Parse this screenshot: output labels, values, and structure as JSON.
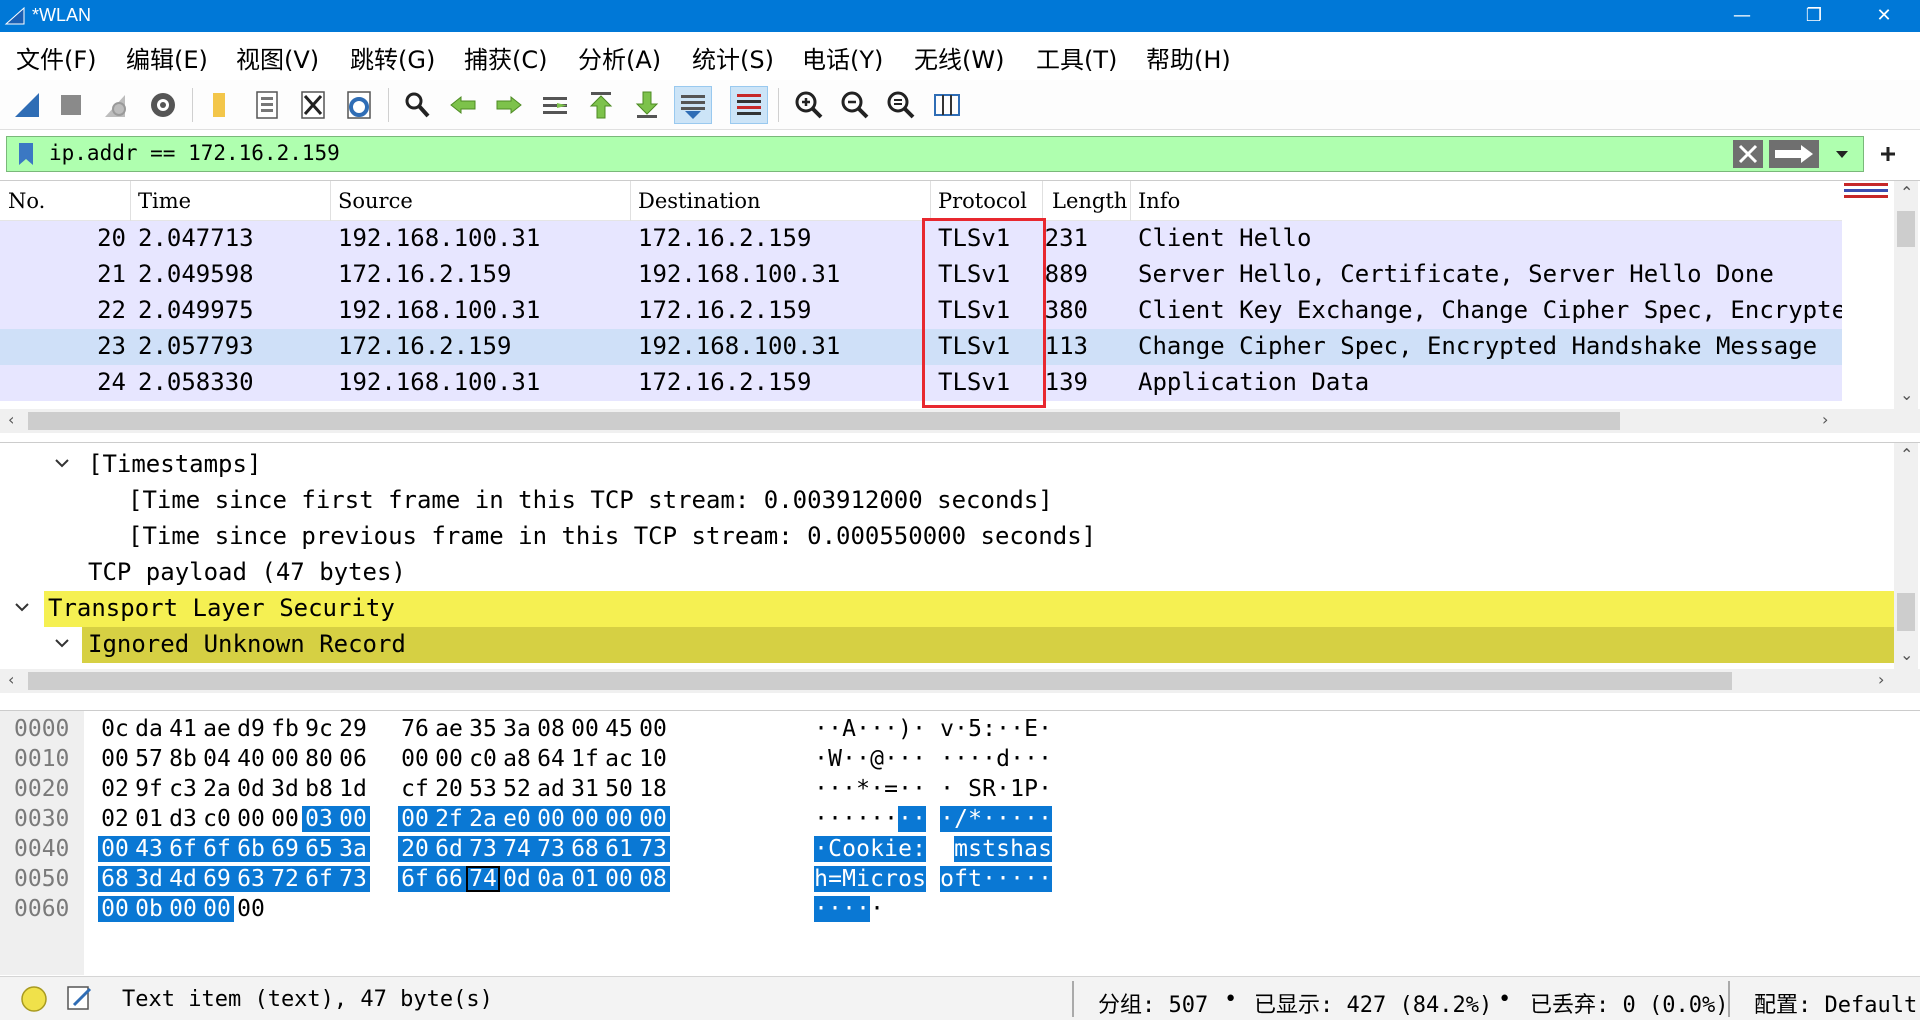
{
  "window": {
    "title": "*WLAN",
    "controls": {
      "minimize": "—",
      "restore": "❐",
      "close": "✕"
    }
  },
  "menu": [
    "文件(F)",
    "编辑(E)",
    "视图(V)",
    "跳转(G)",
    "捕获(C)",
    "分析(A)",
    "统计(S)",
    "电话(Y)",
    "无线(W)",
    "工具(T)",
    "帮助(H)"
  ],
  "toolbar": {
    "icons": [
      "shark-fin-start-icon",
      "stop-capture-icon",
      "restart-capture-icon",
      "capture-options-icon",
      "open-file-icon",
      "save-file-icon",
      "close-file-icon",
      "reload-file-icon",
      "find-packet-icon",
      "go-back-icon",
      "go-forward-icon",
      "go-to-packet-icon",
      "go-first-icon",
      "go-last-icon",
      "autoscroll-icon",
      "colorize-icon",
      "zoom-in-icon",
      "zoom-out-icon",
      "normal-size-icon",
      "resize-columns-icon"
    ]
  },
  "filter": {
    "value": "ip.addr == 172.16.2.159",
    "bg_color": "#afffaf"
  },
  "packet_list": {
    "columns": [
      "No.",
      "Time",
      "Source",
      "Destination",
      "Protocol",
      "Length",
      "Info"
    ],
    "rows": [
      {
        "no": "20",
        "time": "2.047713",
        "src": "192.168.100.31",
        "dst": "172.16.2.159",
        "proto": "TLSv1",
        "len": "231",
        "info": "Client Hello"
      },
      {
        "no": "21",
        "time": "2.049598",
        "src": "172.16.2.159",
        "dst": "192.168.100.31",
        "proto": "TLSv1",
        "len": "889",
        "info": "Server Hello, Certificate, Server Hello Done"
      },
      {
        "no": "22",
        "time": "2.049975",
        "src": "192.168.100.31",
        "dst": "172.16.2.159",
        "proto": "TLSv1",
        "len": "380",
        "info": "Client Key Exchange, Change Cipher Spec, Encrypted"
      },
      {
        "no": "23",
        "time": "2.057793",
        "src": "172.16.2.159",
        "dst": "192.168.100.31",
        "proto": "TLSv1",
        "len": "113",
        "info": "Change Cipher Spec, Encrypted Handshake Message",
        "selected": true
      },
      {
        "no": "24",
        "time": "2.058330",
        "src": "192.168.100.31",
        "dst": "172.16.2.159",
        "proto": "TLSv1",
        "len": "139",
        "info": "Application Data"
      }
    ],
    "row_color": "#e7e6ff",
    "highlight_color": "#e8282f"
  },
  "details": [
    {
      "text": "[Timestamps]",
      "expanded": true,
      "indent": 1
    },
    {
      "text": "[Time since first frame in this TCP stream: 0.003912000 seconds]",
      "indent": 2
    },
    {
      "text": "[Time since previous frame in this TCP stream: 0.000550000 seconds]",
      "indent": 2
    },
    {
      "text": "TCP payload (47 bytes)",
      "indent": 1
    },
    {
      "text": "Transport Layer Security",
      "expanded": true,
      "indent": 0,
      "color": "#f5f052"
    },
    {
      "text": "Ignored Unknown Record",
      "expanded": true,
      "indent": 1,
      "color": "#d6d043"
    }
  ],
  "bytes": {
    "rows": [
      {
        "offset": "0000",
        "hex": [
          "0c",
          "da",
          "41",
          "ae",
          "d9",
          "fb",
          "9c",
          "29",
          "76",
          "ae",
          "35",
          "3a",
          "08",
          "00",
          "45",
          "00"
        ],
        "ascii": [
          "·",
          "·",
          "A",
          "·",
          "·",
          "·",
          ")",
          "·",
          "v",
          "·",
          "5",
          ":",
          "·",
          "·",
          "E",
          "·"
        ]
      },
      {
        "offset": "0010",
        "hex": [
          "00",
          "57",
          "8b",
          "04",
          "40",
          "00",
          "80",
          "06",
          "00",
          "00",
          "c0",
          "a8",
          "64",
          "1f",
          "ac",
          "10"
        ],
        "ascii": [
          "·",
          "W",
          "·",
          "·",
          "@",
          "·",
          "·",
          "·",
          "·",
          "·",
          "·",
          "·",
          "d",
          "·",
          "·",
          "·"
        ]
      },
      {
        "offset": "0020",
        "hex": [
          "02",
          "9f",
          "c3",
          "2a",
          "0d",
          "3d",
          "b8",
          "1d",
          "cf",
          "20",
          "53",
          "52",
          "ad",
          "31",
          "50",
          "18"
        ],
        "ascii": [
          "·",
          "·",
          "·",
          "*",
          "·",
          "=",
          "·",
          "·",
          "·",
          " ",
          "S",
          "R",
          "·",
          "1",
          "P",
          "·"
        ]
      },
      {
        "offset": "0030",
        "hex": [
          "02",
          "01",
          "d3",
          "c0",
          "00",
          "00",
          "03",
          "00",
          "00",
          "2f",
          "2a",
          "e0",
          "00",
          "00",
          "00",
          "00"
        ],
        "ascii": [
          "·",
          "·",
          "·",
          "·",
          "·",
          "·",
          "·",
          "·",
          "·",
          "/",
          "*",
          "·",
          "·",
          "·",
          "·",
          "·"
        ]
      },
      {
        "offset": "0040",
        "hex": [
          "00",
          "43",
          "6f",
          "6f",
          "6b",
          "69",
          "65",
          "3a",
          "20",
          "6d",
          "73",
          "74",
          "73",
          "68",
          "61",
          "73"
        ],
        "ascii": [
          "·",
          "C",
          "o",
          "o",
          "k",
          "i",
          "e",
          ":",
          " ",
          "m",
          "s",
          "t",
          "s",
          "h",
          "a",
          "s"
        ]
      },
      {
        "offset": "0050",
        "hex": [
          "68",
          "3d",
          "4d",
          "69",
          "63",
          "72",
          "6f",
          "73",
          "6f",
          "66",
          "74",
          "0d",
          "0a",
          "01",
          "00",
          "08"
        ],
        "ascii": [
          "h",
          "=",
          "M",
          "i",
          "c",
          "r",
          "o",
          "s",
          "o",
          "f",
          "t",
          "·",
          "·",
          "·",
          "·",
          "·"
        ]
      },
      {
        "offset": "0060",
        "hex": [
          "00",
          "0b",
          "00",
          "00",
          "00"
        ],
        "ascii": [
          "·",
          "·",
          "·",
          "·",
          "·"
        ]
      }
    ],
    "highlight_color": "#0a78d4"
  },
  "status": {
    "item_text": "Text item (text), 47 byte(s)",
    "packets": "分组: 507",
    "displayed": "已显示: 427 (84.2%)",
    "dropped": "已丢弃: 0 (0.0%)",
    "profile": "配置: Default",
    "sep": "•"
  }
}
